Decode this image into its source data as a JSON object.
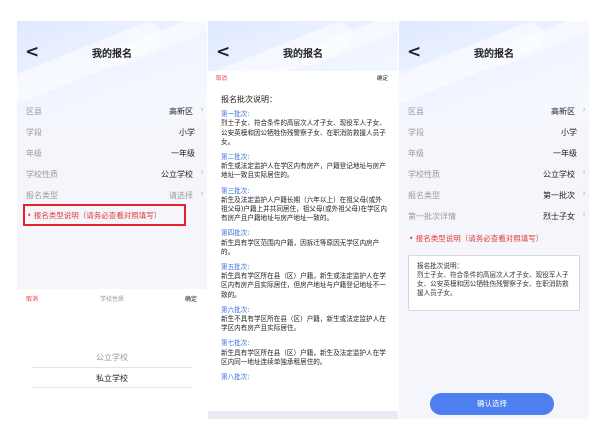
{
  "colors": {
    "accent_red": "#e23b3b",
    "highlight_red": "#e8202a",
    "link_blue": "#3a6fe0",
    "button_blue": "#4d7ff0"
  },
  "panel1": {
    "title": "我的报名",
    "rows": [
      {
        "label": "区县",
        "value": "高新区"
      },
      {
        "label": "学段",
        "value": "小学"
      },
      {
        "label": "年级",
        "value": "一年级"
      },
      {
        "label": "学校性质",
        "value": "公立学校"
      },
      {
        "label": "报名类型",
        "value": "请选择"
      }
    ],
    "notice": "• 报名类型说明（请务必查看对照填写）",
    "picker": {
      "cancel": "取消",
      "title": "学校性质",
      "confirm": "确定",
      "options": [
        "公立学校",
        "私立学校"
      ]
    }
  },
  "panel2": {
    "title": "我的报名",
    "cancel": "取消",
    "confirm": "确定",
    "heading": "报名批次说明：",
    "sections": [
      {
        "title": "第一批次:",
        "desc": "烈士子女、符合条件的高层次人才子女、现役军人子女、公安英模和因公牺牲伤残警察子女、在职消防救援人员子女。"
      },
      {
        "title": "第二批次:",
        "desc": "新生或法定监护人在学区内有房产，户籍登记地址与房产地址一致且实际居住的。"
      },
      {
        "title": "第三批次:",
        "desc": "新生及法定监护人户籍长期（六年以上）在祖父母(或外祖父母)户籍上并共同居住，祖父母(或外祖父母)在学区内有房产且户籍地址与房产地址一致的。"
      },
      {
        "title": "第四批次:",
        "desc": "新生具有学区范围内户籍，因拆迁等原因无学区内房产的。"
      },
      {
        "title": "第五批次:",
        "desc": "新生具有学区所在县（区）户籍，新生或法定监护人在学区内有房产且实际居住，但房产地址与户籍登记地址不一致的。"
      },
      {
        "title": "第六批次:",
        "desc": "新生不具有学区所在县（区）户籍，新生或法定监护人在学区内有房产且实际居住。"
      },
      {
        "title": "第七批次:",
        "desc": "新生具有学区所在县（区）户籍，新生及法定监护人在学区内同一地址连续单独承租居住的。"
      },
      {
        "title": "第八批次:",
        "desc": ""
      }
    ]
  },
  "panel3": {
    "title": "我的报名",
    "rows": [
      {
        "label": "区县",
        "value": "高新区"
      },
      {
        "label": "学段",
        "value": "小学"
      },
      {
        "label": "年级",
        "value": "一年级"
      },
      {
        "label": "学校性质",
        "value": "公立学校"
      },
      {
        "label": "报名类型",
        "value": "第一批次"
      },
      {
        "label": "第一批次详情",
        "value": "烈士子女"
      }
    ],
    "notice": "• 报名类型说明（请务必查看对照填写）",
    "desc_title": "报名批次说明：",
    "desc_text": "烈士子女、符合条件的高层次人才子女、现役军人子女、公安英模和因公牺牲伤残警察子女、在职消防救援人员子女。",
    "confirm_button": "确认选择"
  }
}
